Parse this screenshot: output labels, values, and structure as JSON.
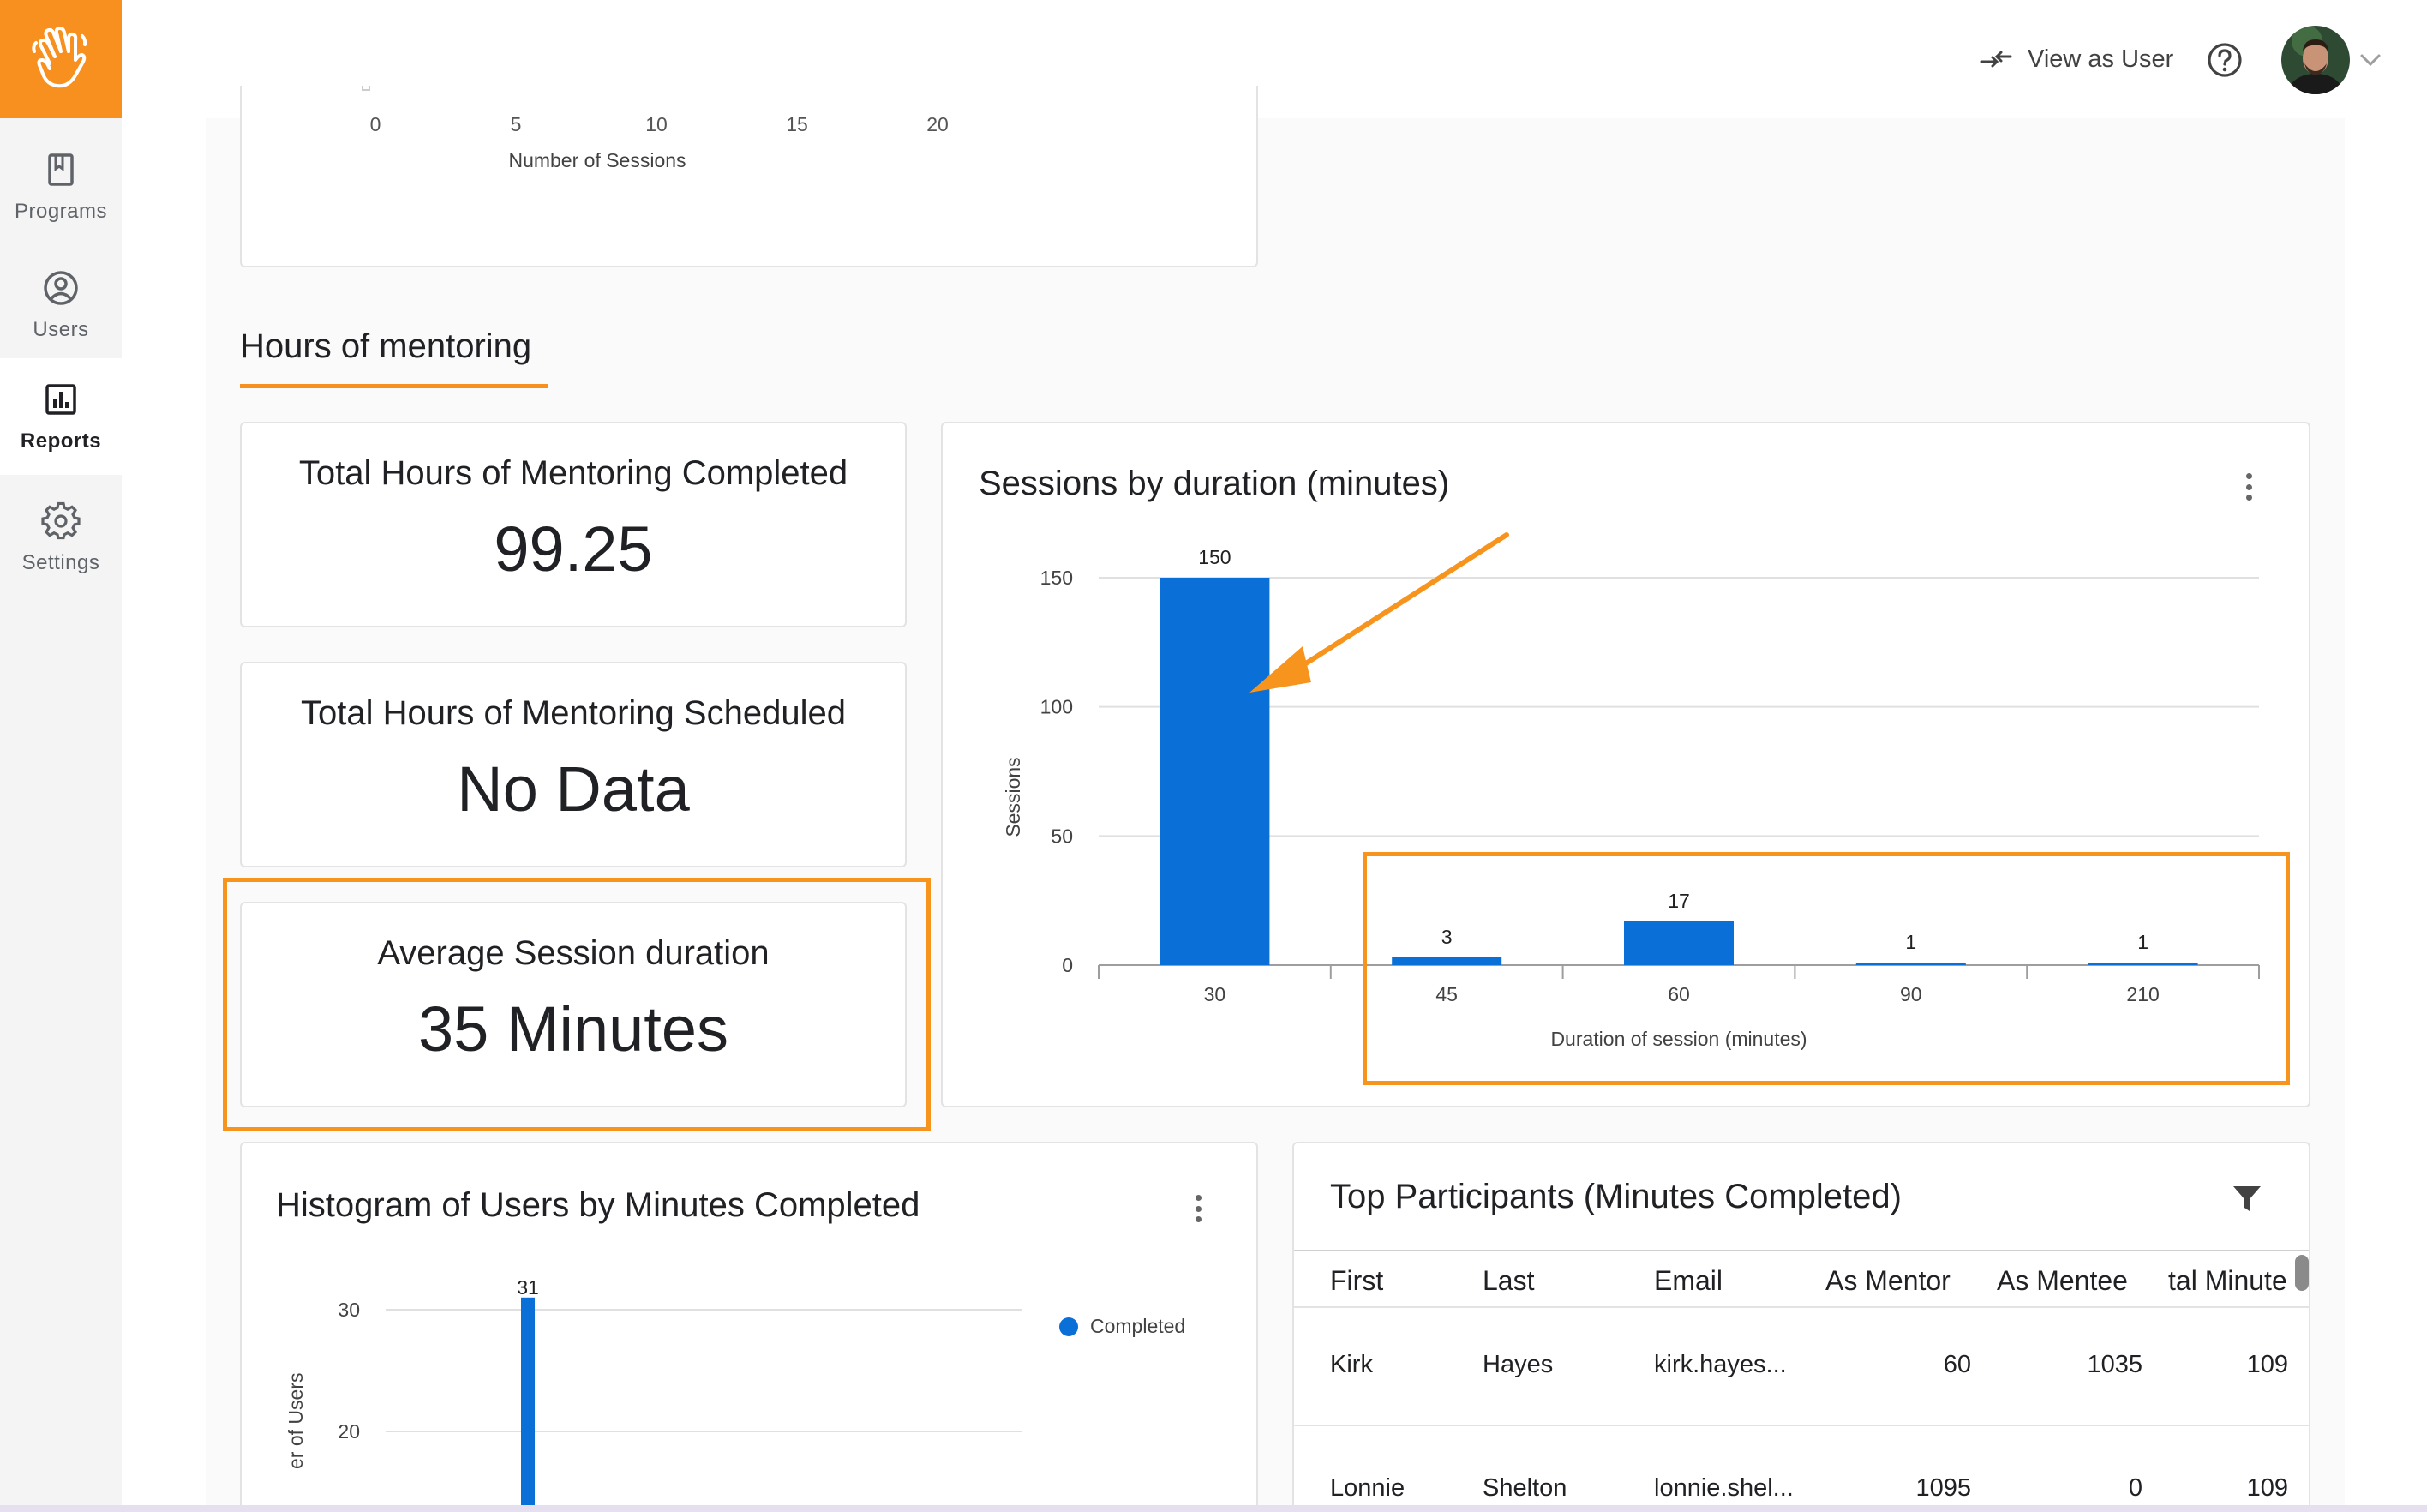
{
  "sidebar": {
    "logo_icon": "hand-wave-icon",
    "items": [
      {
        "label": "Programs",
        "icon": "bookmark-icon",
        "active": false
      },
      {
        "label": "Users",
        "icon": "user-circle-icon",
        "active": false
      },
      {
        "label": "Reports",
        "icon": "bar-chart-icon",
        "active": true
      },
      {
        "label": "Settings",
        "icon": "gear-icon",
        "active": false
      }
    ]
  },
  "header": {
    "view_as_user_label": "View as User",
    "help_icon": "help-circle-icon",
    "avatar_icon": "user-avatar",
    "caret_icon": "chevron-down-icon"
  },
  "partial_chart": {
    "ticks": [
      "0",
      "5",
      "10",
      "15",
      "20"
    ],
    "xlabel": "Number of Sessions"
  },
  "section": {
    "title": "Hours of mentoring"
  },
  "stats": [
    {
      "title": "Total Hours of Mentoring Completed",
      "value": "99.25"
    },
    {
      "title": "Total Hours of Mentoring Scheduled",
      "value": "No Data"
    },
    {
      "title": "Average Session duration",
      "value": "35 Minutes"
    }
  ],
  "sessions_card": {
    "title": "Sessions by duration (minutes)"
  },
  "histogram_card": {
    "title": "Histogram of Users by Minutes Completed",
    "legend": "Completed",
    "ylabel_visible": "er of Users"
  },
  "participants_card": {
    "title": "Top Participants (Minutes Completed)",
    "filter_icon": "filter-icon",
    "columns": [
      "First",
      "Last",
      "Email",
      "As Mentor",
      "As Mentee",
      "tal Minute"
    ],
    "rows": [
      [
        "Kirk",
        "Hayes",
        "kirk.hayes...",
        "60",
        "1035",
        "109"
      ],
      [
        "Lonnie",
        "Shelton",
        "lonnie.shel...",
        "1095",
        "0",
        "109"
      ]
    ]
  },
  "colors": {
    "accent": "#f7941d",
    "bar": "#0a6fd6",
    "sidebar_bg": "#f4f4f4"
  },
  "chart_data": [
    {
      "type": "bar",
      "title": "Sessions by duration (minutes)",
      "xlabel": "Duration of session (minutes)",
      "ylabel": "Sessions",
      "categories": [
        "30",
        "45",
        "60",
        "90",
        "210"
      ],
      "values": [
        150,
        3,
        17,
        1,
        1
      ],
      "data_labels": [
        "150",
        "3",
        "17",
        "1",
        "1"
      ],
      "ylim": [
        0,
        150
      ],
      "yticks": [
        "0",
        "50",
        "100",
        "150"
      ],
      "grid": true
    },
    {
      "type": "bar",
      "title": "Histogram of Users by Minutes Completed",
      "ylabel": "er of Users",
      "legend": [
        "Completed"
      ],
      "legend_position": "top-right",
      "yticks": [
        "20",
        "30"
      ],
      "values": [
        31
      ],
      "data_labels": [
        "31"
      ],
      "grid": true
    }
  ]
}
